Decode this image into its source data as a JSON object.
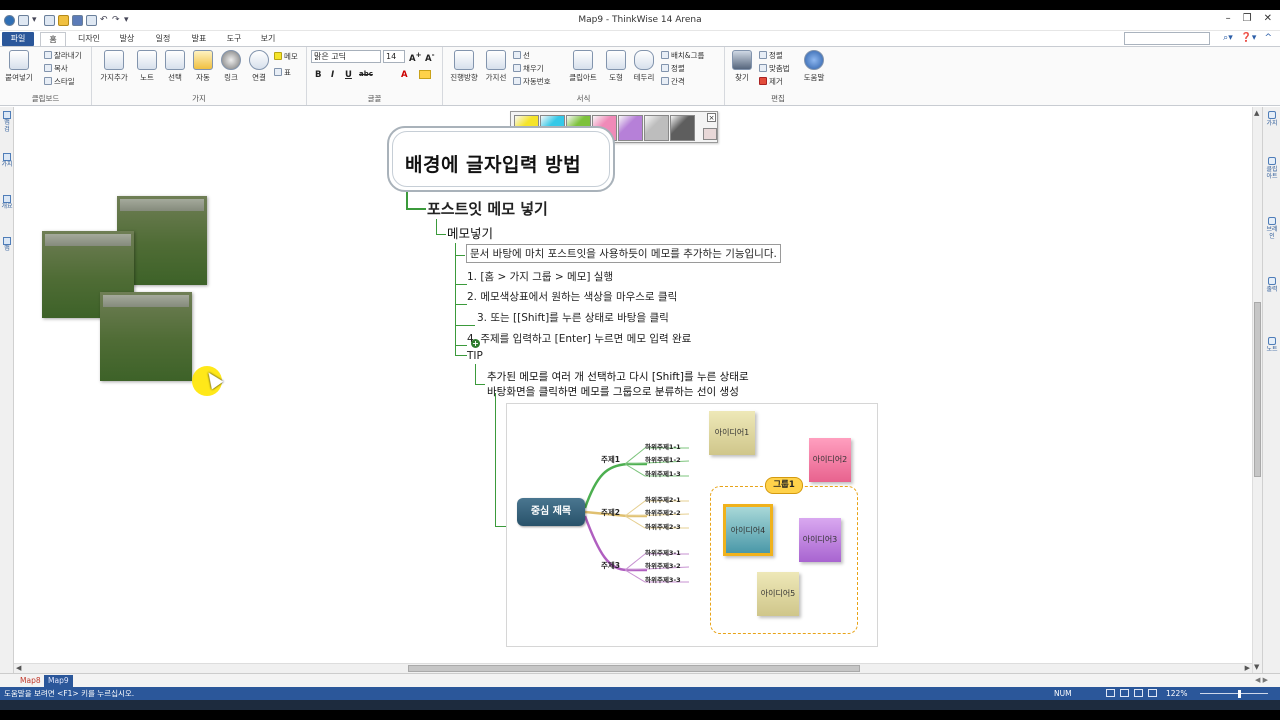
{
  "window": {
    "title": "Map9 - ThinkWise 14 Arena"
  },
  "tabs": [
    "파일",
    "홈",
    "디자인",
    "발상",
    "일정",
    "발표",
    "도구",
    "보기"
  ],
  "ribbon": {
    "clipboard": {
      "paste": "붙여넣기",
      "cut": "잘라내기",
      "copy": "복사",
      "style": "스타일",
      "label": "클립보드"
    },
    "branch": {
      "add_branch": "가지추가",
      "note": "노트",
      "select": "선택",
      "auto": "자동",
      "link": "링크",
      "connect": "연결",
      "memo": "메모",
      "table": "표",
      "label": "가지"
    },
    "font": {
      "font_name": "맑은 고딕",
      "font_size": "14",
      "bold": "B",
      "italic": "I",
      "underline": "U",
      "strike": "abc",
      "color_a": "A",
      "label": "글꼴"
    },
    "format": {
      "direction": "진행방향",
      "branch_line": "가지선",
      "line": "선",
      "fill": "채우기",
      "auto_number": "자동번호",
      "clipart": "클립아트",
      "shape": "도형",
      "border": "테두리",
      "background_image": "배치&그룹",
      "align": "정렬",
      "spacing": "간격",
      "label": "서식"
    },
    "edit": {
      "find": "찾기",
      "sort": "정렬",
      "spelling": "맞춤법",
      "remove": "제거",
      "help": "도움말",
      "label": "편집"
    }
  },
  "left_strip": [
    "맵 검",
    "가지",
    "개요",
    "맵"
  ],
  "right_strip": [
    "가지",
    "클립아트",
    "브레인",
    "출력",
    "노트"
  ],
  "palette": {
    "colors": [
      "#f5e42a",
      "#35c9e8",
      "#7dc23c",
      "#f08ab8",
      "#b680d8",
      "#bdbdbd",
      "#5e5e5e"
    ],
    "close": "×"
  },
  "mindmap": {
    "root": "배경에 글자입력 방법",
    "topic1": "포스트잇 메모 넣기",
    "topic2": "메모넣기",
    "items": [
      "문서 바탕에 마치 포스트잇을 사용하듯이 메모를 추가하는 기능입니다.",
      "1. [홈 > 가지 그룹 > 메모] 실행",
      "2. 메모색상표에서 원하는 색상을 마우스로 클릭",
      "3. 또는 [[Shift]를 누른 상태로 바탕을 클릭",
      "4. 주제를 입력하고 [Enter] 누르면 메모 입력 완료",
      "TIP"
    ],
    "tip_line1": "추가된 메모를 여러 개 선택하고 다시 [Shift]를 누른 상태로",
    "tip_line2": "바탕화면을 클릭하면 메모를 그룹으로 분류하는 선이 생성",
    "plus": "+"
  },
  "picture": {
    "central": "중심 제목",
    "topics": [
      "주제1",
      "주제2",
      "주제3"
    ],
    "subs": [
      [
        "하위주제1-1",
        "하위주제1-2",
        "하위주제1-3"
      ],
      [
        "하위주제2-1",
        "하위주제2-2",
        "하위주제2-3"
      ],
      [
        "하위주제3-1",
        "하위주제3-2",
        "하위주제3-3"
      ]
    ],
    "ideas": [
      "아이디어1",
      "아이디어2",
      "아이디어3",
      "아이디어4",
      "아이디어5"
    ],
    "group": "그룹1"
  },
  "sheet_tabs": [
    "Map8",
    "Map9"
  ],
  "status": {
    "text": "도움말을 보려면 <F1> 키를 누르십시오.",
    "num": "NUM",
    "zoom": "122%"
  }
}
